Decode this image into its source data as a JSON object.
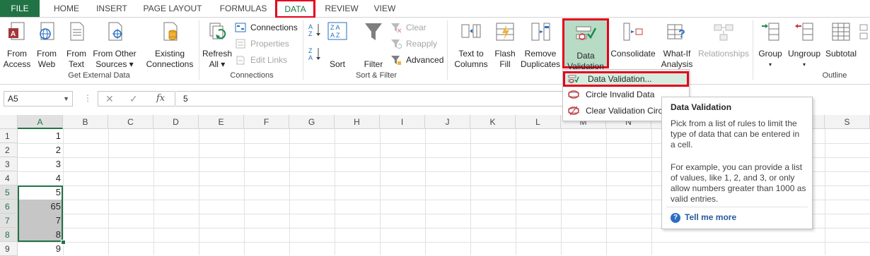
{
  "tabs": {
    "file": "FILE",
    "home": "HOME",
    "insert": "INSERT",
    "page_layout": "PAGE LAYOUT",
    "formulas": "FORMULAS",
    "data": "DATA",
    "review": "REVIEW",
    "view": "VIEW"
  },
  "ribbon": {
    "get_external_data": {
      "label": "Get External Data",
      "from_access": [
        "From",
        "Access"
      ],
      "from_web": [
        "From",
        "Web"
      ],
      "from_text": [
        "From",
        "Text"
      ],
      "from_other": [
        "From Other",
        "Sources ▾"
      ],
      "existing": [
        "Existing",
        "Connections"
      ]
    },
    "connections": {
      "label": "Connections",
      "refresh": [
        "Refresh",
        "All ▾"
      ],
      "connections": "Connections",
      "properties": "Properties",
      "edit_links": "Edit Links"
    },
    "sort_filter": {
      "label": "Sort & Filter",
      "sort": "Sort",
      "filter": "Filter",
      "clear": "Clear",
      "reapply": "Reapply",
      "advanced": "Advanced"
    },
    "data_tools": {
      "text_to_columns": [
        "Text to",
        "Columns"
      ],
      "flash_fill": [
        "Flash",
        "Fill"
      ],
      "remove_duplicates": [
        "Remove",
        "Duplicates"
      ],
      "data_validation": [
        "Data",
        "Validation ▾"
      ],
      "consolidate": "Consolidate",
      "what_if": [
        "What-If",
        "Analysis ▾"
      ],
      "relationships": "Relationships"
    },
    "outline": {
      "label": "Outline",
      "group": [
        "Group",
        "▾"
      ],
      "ungroup": [
        "Ungroup",
        "▾"
      ],
      "subtotal": "Subtotal"
    }
  },
  "formula_bar": {
    "name_box": "A5",
    "value": "5",
    "fx": "fx"
  },
  "grid": {
    "columns": [
      "A",
      "B",
      "C",
      "D",
      "E",
      "F",
      "G",
      "H",
      "I",
      "J",
      "K",
      "L",
      "M",
      "N",
      "",
      "S"
    ],
    "rows": [
      "1",
      "2",
      "3",
      "4",
      "5",
      "6",
      "7",
      "8",
      "9"
    ],
    "column_a_values": [
      "1",
      "2",
      "3",
      "4",
      "5",
      "65",
      "7",
      "8",
      "9"
    ]
  },
  "dropdown": {
    "items": [
      "Data Validation...",
      "Circle Invalid Data",
      "Clear Validation Circles"
    ]
  },
  "tooltip": {
    "title": "Data Validation",
    "para1": "Pick from a list of rules to limit the type of data that can be entered in a cell.",
    "para2": "For example, you can provide a list of values, like 1, 2, and 3, or only allow numbers greater than 1000 as valid entries.",
    "link": "Tell me more"
  },
  "colors": {
    "excel_green": "#217346",
    "highlight_red": "#e3001b",
    "selection_grey": "#c6c6c6"
  }
}
